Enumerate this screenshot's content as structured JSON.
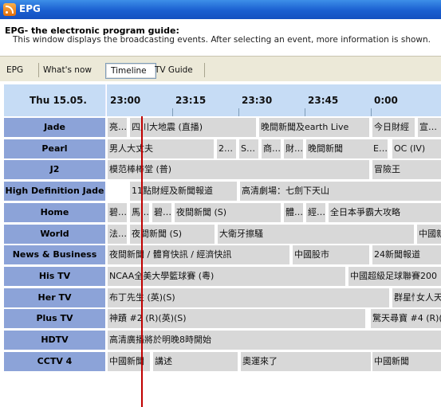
{
  "window": {
    "title": "EPG"
  },
  "header": {
    "title": "EPG- the electronic program guide:",
    "description": "This window displays the broadcasting events. After selecting an event, more information is shown."
  },
  "tabs": [
    "EPG",
    "What's now",
    "Timeline",
    "TV Guide"
  ],
  "active_tab": "Timeline",
  "timeline": {
    "date": "Thu 15.05.",
    "times": [
      "23:00",
      "23:15",
      "23:30",
      "23:45",
      "0:00"
    ]
  },
  "channels": [
    {
      "name": "Jade",
      "programs": [
        "亮…",
        "四川大地震 (直播)",
        "晚間新聞及earth Live",
        "今日財經",
        "宣…"
      ]
    },
    {
      "name": "Pearl",
      "programs": [
        "男人大丈夫",
        "2…",
        "S…",
        "商…",
        "財…",
        "晚間新聞",
        "E…",
        "OC (IV)"
      ]
    },
    {
      "name": "J2",
      "programs": [
        "模范棒棒堂 (普)",
        "冒險王"
      ]
    },
    {
      "name": "High Definition Jade",
      "programs": [
        "11點財經及新聞報道",
        "高清劇場：七劍下天山"
      ]
    },
    {
      "name": "Home",
      "programs": [
        "碧…",
        "馬…",
        "碧…",
        "夜間新聞 (S)",
        "體…",
        "經…",
        "全日本爭霸大攻略"
      ]
    },
    {
      "name": "World",
      "programs": [
        "法…",
        "夜間新聞 (S)",
        "大衛牙擦騷",
        "中國新"
      ]
    },
    {
      "name": "News & Business",
      "programs": [
        "夜間新聞 / 體育快訊 / 經濟快訊",
        "中國股市",
        "24新聞報道"
      ]
    },
    {
      "name": "His TV",
      "programs": [
        "NCAA全美大學籃球賽 (粵)",
        "中國超級足球聯賽200"
      ]
    },
    {
      "name": "Her TV",
      "programs": [
        "布丁先生 (英)(S)",
        "群星情…",
        "女人天"
      ]
    },
    {
      "name": "Plus TV",
      "programs": [
        "神蹟 #2 (R)(英)(S)",
        "驚天尋寶 #4 (R)("
      ]
    },
    {
      "name": "HDTV",
      "programs": [
        "高清廣播將於明晚8時開始"
      ]
    },
    {
      "name": "CCTV 4",
      "programs": [
        "中國新聞",
        "講述",
        "奧運來了",
        "中國新聞",
        "中國"
      ]
    }
  ],
  "colors": {
    "channel_bg": "#8ca3d8",
    "program_bg": "#d8d8d8",
    "timeline_bg": "#c6dcf5",
    "now_marker": "#c00000"
  }
}
